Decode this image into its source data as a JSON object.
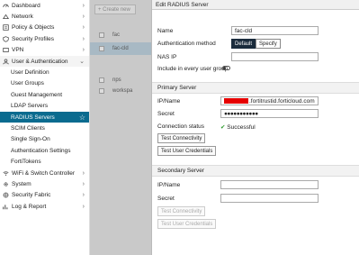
{
  "sidebar": {
    "items": [
      {
        "label": "Dashboard",
        "icon": "dashboard-icon"
      },
      {
        "label": "Network",
        "icon": "network-icon"
      },
      {
        "label": "Policy & Objects",
        "icon": "policy-icon"
      },
      {
        "label": "Security Profiles",
        "icon": "shield-icon"
      },
      {
        "label": "VPN",
        "icon": "vpn-icon"
      },
      {
        "label": "User & Authentication",
        "icon": "user-icon"
      }
    ],
    "sub_items": [
      "User Definition",
      "User Groups",
      "Guest Management",
      "LDAP Servers",
      "RADIUS Servers",
      "SCIM Clients",
      "Single Sign-On",
      "Authentication Settings",
      "FortiTokens"
    ],
    "items_after": [
      {
        "label": "WiFi & Switch Controller",
        "icon": "wifi-icon"
      },
      {
        "label": "System",
        "icon": "gear-icon"
      },
      {
        "label": "Security Fabric",
        "icon": "fabric-icon"
      },
      {
        "label": "Log & Report",
        "icon": "log-icon"
      }
    ]
  },
  "background": {
    "create_new": "+ Create new",
    "rows": [
      "fac",
      "fac-cld",
      "nps",
      "workspa"
    ]
  },
  "dialog": {
    "title": "Edit RADIUS Server",
    "name_label": "Name",
    "name_value": "fac-cld",
    "auth_method_label": "Authentication method",
    "auth_default": "Default",
    "auth_specify": "Specify",
    "nas_ip_label": "NAS IP",
    "include_label": "Include in every user group",
    "primary_title": "Primary Server",
    "ip_label": "IP/Name",
    "primary_ip_suffix": ".fortitrustid.forticloud.com",
    "secret_label": "Secret",
    "primary_secret": "●●●●●●●●●●●",
    "conn_status_label": "Connection status",
    "conn_status_value": "Successful",
    "test_connectivity": "Test Connectivity",
    "test_credentials": "Test User Credentials",
    "secondary_title": "Secondary Server",
    "secondary_ip_label": "IP/Name",
    "secondary_secret_label": "Secret"
  }
}
